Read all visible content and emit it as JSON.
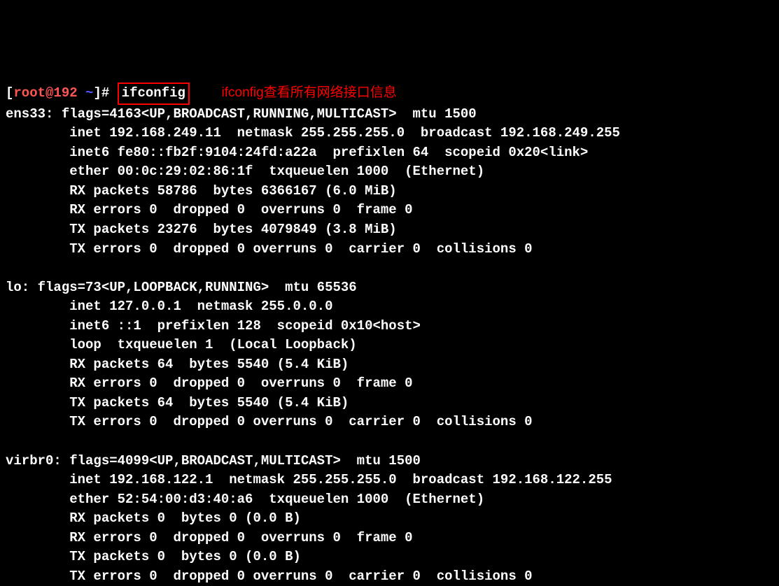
{
  "prompt": {
    "open": "[",
    "user": "root",
    "at": "@",
    "host": "192",
    "path": " ~",
    "close": "]",
    "hash": "# "
  },
  "command": "ifconfig",
  "annotation_spacing": "    ",
  "annotation": "ifconfig查看所有网络接口信息",
  "interfaces": {
    "ens33": {
      "header": "ens33: flags=4163<UP,BROADCAST,RUNNING,MULTICAST>  mtu 1500",
      "inet": "        inet 192.168.249.11  netmask 255.255.255.0  broadcast 192.168.249.255",
      "inet6": "        inet6 fe80::fb2f:9104:24fd:a22a  prefixlen 64  scopeid 0x20<link>",
      "ether": "        ether 00:0c:29:02:86:1f  txqueuelen 1000  (Ethernet)",
      "rx_packets": "        RX packets 58786  bytes 6366167 (6.0 MiB)",
      "rx_errors": "        RX errors 0  dropped 0  overruns 0  frame 0",
      "tx_packets": "        TX packets 23276  bytes 4079849 (3.8 MiB)",
      "tx_errors": "        TX errors 0  dropped 0 overruns 0  carrier 0  collisions 0"
    },
    "lo": {
      "header": "lo: flags=73<UP,LOOPBACK,RUNNING>  mtu 65536",
      "inet": "        inet 127.0.0.1  netmask 255.0.0.0",
      "inet6": "        inet6 ::1  prefixlen 128  scopeid 0x10<host>",
      "loop": "        loop  txqueuelen 1  (Local Loopback)",
      "rx_packets": "        RX packets 64  bytes 5540 (5.4 KiB)",
      "rx_errors": "        RX errors 0  dropped 0  overruns 0  frame 0",
      "tx_packets": "        TX packets 64  bytes 5540 (5.4 KiB)",
      "tx_errors": "        TX errors 0  dropped 0 overruns 0  carrier 0  collisions 0"
    },
    "virbr0": {
      "header": "virbr0: flags=4099<UP,BROADCAST,MULTICAST>  mtu 1500",
      "inet": "        inet 192.168.122.1  netmask 255.255.255.0  broadcast 192.168.122.255",
      "ether": "        ether 52:54:00:d3:40:a6  txqueuelen 1000  (Ethernet)",
      "rx_packets": "        RX packets 0  bytes 0 (0.0 B)",
      "rx_errors": "        RX errors 0  dropped 0  overruns 0  frame 0",
      "tx_packets": "        TX packets 0  bytes 0 (0.0 B)",
      "tx_errors": "        TX errors 0  dropped 0 overruns 0  carrier 0  collisions 0"
    }
  }
}
